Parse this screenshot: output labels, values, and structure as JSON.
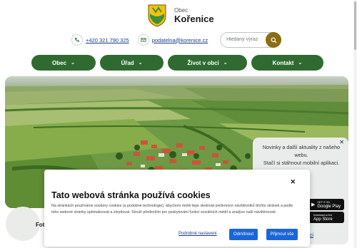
{
  "header": {
    "org_small": "Obec",
    "org_name": "Kořenice",
    "phone": "+420 321 790 325",
    "email": "podatelna@korenice.cz",
    "phone_icon": "phone-icon",
    "email_icon": "mail-icon"
  },
  "search": {
    "placeholder": "Hledaný výraz",
    "icon": "search-icon"
  },
  "nav": {
    "items": [
      {
        "label": "Obec"
      },
      {
        "label": "Úřad"
      },
      {
        "label": "Život v obci"
      },
      {
        "label": "Kontakt"
      }
    ]
  },
  "app_promo": {
    "text_1": "Novinky a další aktuality z našeho webu.",
    "text_2": "Stačí si stáhnout mobilní aplikaci.",
    "google_small": "GET IT ON",
    "google_label": "Google Play",
    "apple_small": "Download on the",
    "apple_label": "App Store",
    "link_fragment": "aci"
  },
  "below": {
    "label_fragment": "Fot"
  },
  "cookie": {
    "title": "Tato webová stránka používá cookies",
    "body": "Na stránkách používáme soubory cookies (a podobné technologie), abychom mohli lépe sledovat preference návštěvníků těchto stránek a podle toho webové stránky optimalizovat a zlepšovat. Slouží především pro poskytování funkcí sociálních médií a analýze naší návštěvnosti.",
    "settings_label": "Podrobné nastavení",
    "reject_label": "Odmítnout",
    "accept_label": "Přijmout vše"
  },
  "colors": {
    "nav_green": "#2f6b31",
    "search_gold": "#8a6d14",
    "primary_blue": "#1b66d6"
  }
}
